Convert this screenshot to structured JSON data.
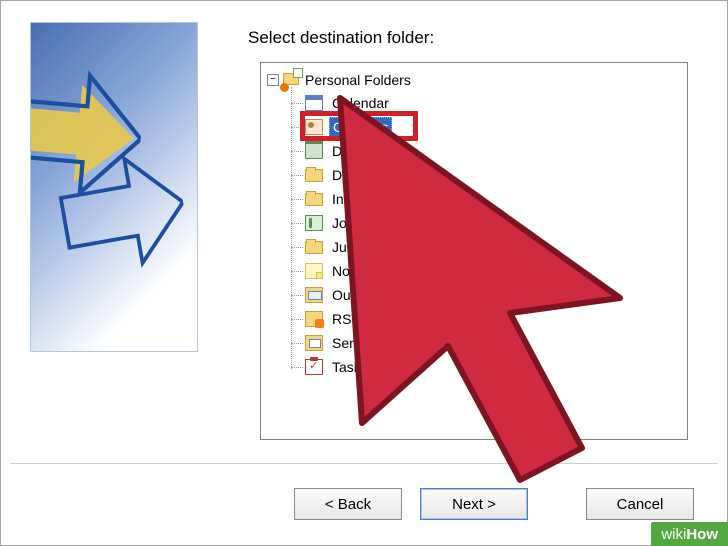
{
  "prompt": "Select destination folder:",
  "tree": {
    "root_label": "Personal Folders",
    "expander_glyph": "−",
    "items": [
      {
        "label": "Calendar",
        "icon": "calendar-icon",
        "selected": false
      },
      {
        "label": "Contacts",
        "icon": "contacts-icon",
        "selected": true
      },
      {
        "label": "Deleted Items",
        "icon": "trash-icon",
        "selected": false
      },
      {
        "label": "Drafts",
        "icon": "folder-icon",
        "selected": false
      },
      {
        "label": "Inbox",
        "icon": "folder-icon",
        "selected": false
      },
      {
        "label": "Journal",
        "icon": "journal-icon",
        "selected": false
      },
      {
        "label": "Junk E-mail",
        "icon": "folder-icon",
        "selected": false
      },
      {
        "label": "Notes",
        "icon": "notes-icon",
        "selected": false
      },
      {
        "label": "Outbox",
        "icon": "outbox-icon",
        "selected": false
      },
      {
        "label": "RSS Feeds",
        "icon": "rss-icon",
        "selected": false
      },
      {
        "label": "Sent Items",
        "icon": "sent-icon",
        "selected": false
      },
      {
        "label": "Tasks",
        "icon": "tasks-icon",
        "selected": false
      }
    ]
  },
  "buttons": {
    "back": "< Back",
    "next": "Next >",
    "cancel": "Cancel"
  },
  "watermark": {
    "prefix": "wiki",
    "suffix": "How"
  },
  "colors": {
    "selection_bg": "#2f6ac0",
    "highlight_border": "#d11f2a",
    "cursor_fill": "#cf2a3f"
  }
}
